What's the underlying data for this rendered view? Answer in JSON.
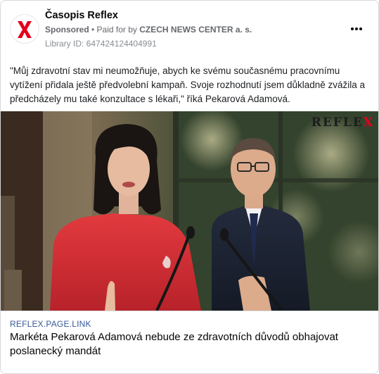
{
  "post": {
    "page_name": "Časopis Reflex",
    "sponsored_label": "Sponsored",
    "separator": " • ",
    "paid_for_prefix": "Paid for by ",
    "advertiser": "CZECH NEWS CENTER a. s.",
    "library_id": "Library ID: 647424124404991",
    "more_icon": "more-horizontal-icon",
    "text": "\"Můj zdravotní stav mi neumožňuje, abych ke svému současnému pracovnímu vytížení přidala ještě předvolební kampaň. Svoje rozhodnutí jsem důkladně zvážila a předcházely mu také konzultace s lékaři,\" říká Pekarová Adamová."
  },
  "media": {
    "watermark_text": "REFLE",
    "watermark_x": "X",
    "brand_red": "#e3001b"
  },
  "link": {
    "domain": "REFLEX.PAGE.LINK",
    "title": "Markéta Pekarová Adamová nebude ze zdravotních důvodů obhajovat poslanecký mandát"
  }
}
